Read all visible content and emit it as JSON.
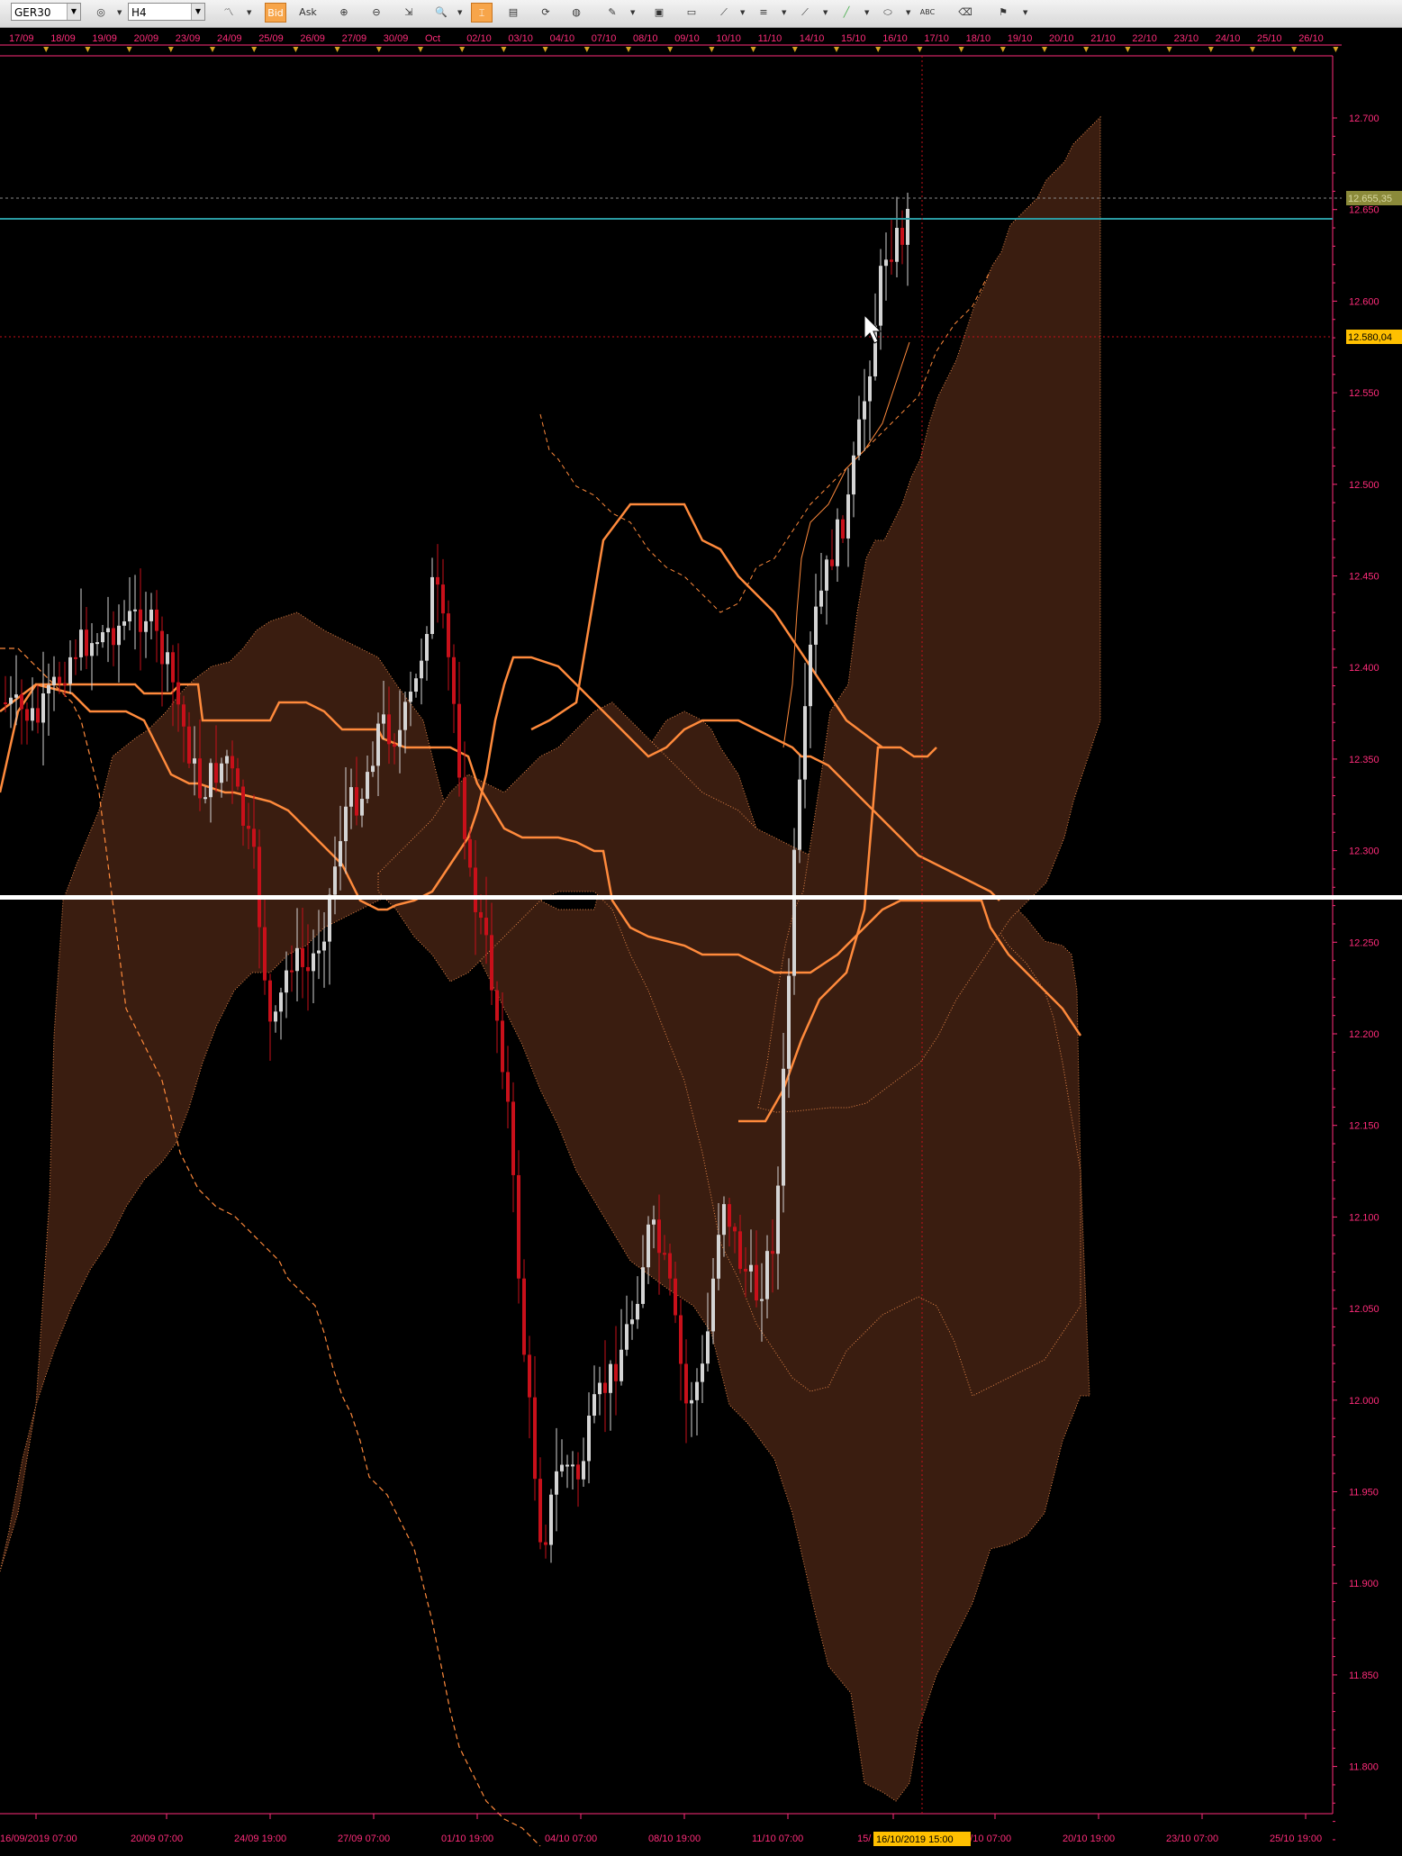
{
  "toolbar": {
    "symbol": "GER30",
    "timeframe": "H4",
    "bid_label": "Bid",
    "ask_label": "Ask",
    "abc_label": "ABC",
    "icons": [
      "chart-type-icon",
      "graph-icon",
      "zoom-in-icon",
      "zoom-out-icon",
      "autoscroll-icon",
      "zoom-icon",
      "period-separator-icon",
      "template-icon",
      "refresh-icon",
      "globe-icon",
      "pencil-icon",
      "image-icon",
      "window-icon",
      "line-study-icon",
      "list-icon",
      "trend-icon",
      "line-icon",
      "ellipse-icon",
      "text-icon",
      "eraser-icon",
      "objects-icon"
    ]
  },
  "top_dates": [
    "17/09",
    "18/09",
    "19/09",
    "20/09",
    "23/09",
    "24/09",
    "25/09",
    "26/09",
    "27/09",
    "30/09",
    "Oct",
    "02/10",
    "03/10",
    "04/10",
    "07/10",
    "08/10",
    "09/10",
    "10/10",
    "11/10",
    "14/10",
    "15/10",
    "16/10",
    "17/10",
    "18/10",
    "19/10",
    "20/10",
    "21/10",
    "22/10",
    "23/10",
    "24/10",
    "25/10",
    "26/10"
  ],
  "bottom_dates": [
    "16/09/2019 07:00",
    "20/09 07:00",
    "24/09 19:00",
    "27/09 07:00",
    "01/10 19:00",
    "04/10 07:00",
    "08/10 19:00",
    "11/10 07:00",
    "15/",
    "18/10 07:00",
    "20/10 19:00",
    "23/10 07:00",
    "25/10 19:00"
  ],
  "crosshair_date": "16/10/2019 15:00",
  "price_labels": [
    "12.700",
    "12.650",
    "12.600",
    "12.550",
    "12.500",
    "12.450",
    "12.400",
    "12.350",
    "12.300",
    "12.250",
    "12.200",
    "12.150",
    "12.100",
    "12.050",
    "12.000",
    "11.950",
    "11.900",
    "11.850",
    "11.800"
  ],
  "current_price_label": "12.655,35",
  "crosshair_price_label": "12.580,04",
  "colors": {
    "axis": "#ff2c7a",
    "bull": "#d4d4d4",
    "bear": "#c8101a",
    "ichimoku": "#ff8a3c",
    "cloud": "#3a1d10",
    "hline": "#2a9aa2",
    "price_tag": "#8b8a3a",
    "crosshair_tag": "#ffc000"
  }
}
